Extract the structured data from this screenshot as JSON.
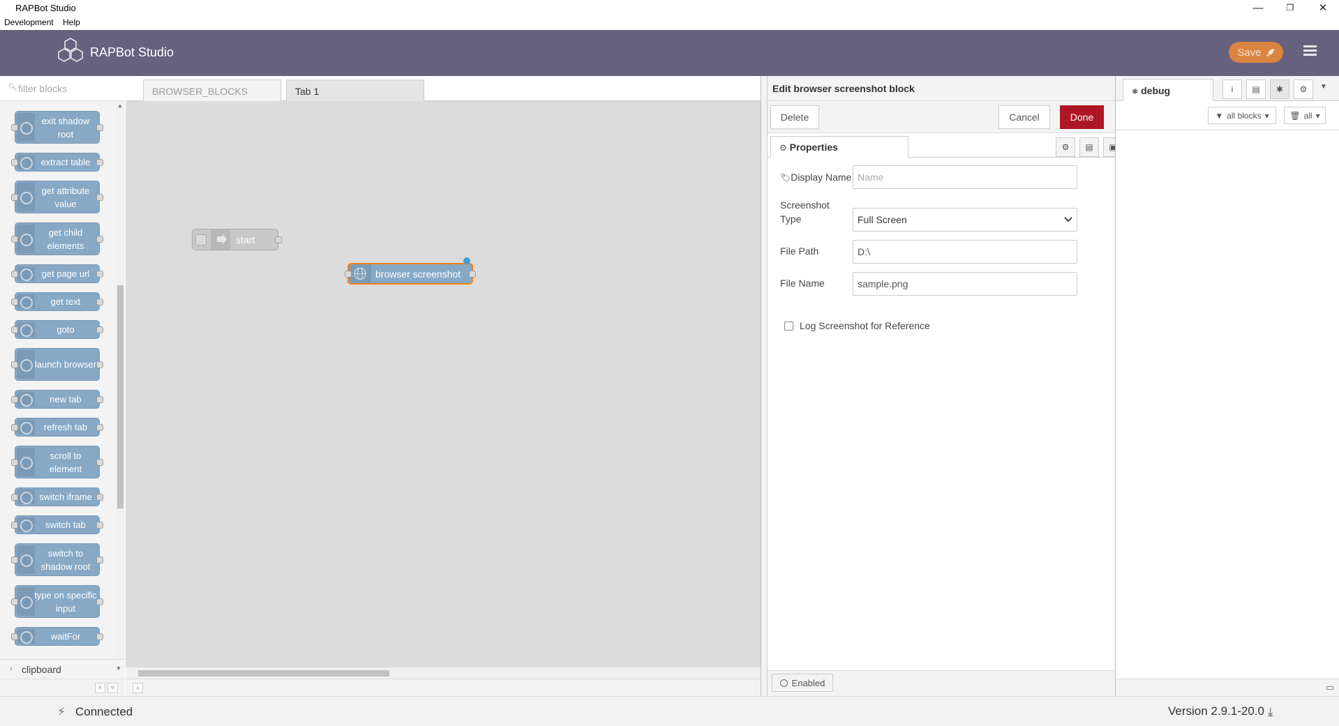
{
  "window": {
    "title": "RAPBot Studio",
    "minimize": "—",
    "restore": "❐",
    "close": "✕"
  },
  "menu": [
    "Development",
    "Help"
  ],
  "header": {
    "brand": "RAPBot Studio",
    "save_label": "Save",
    "accent": "#d98440"
  },
  "palette": {
    "filter_placeholder": "filter blocks",
    "blocks": [
      {
        "label": "exit shadow root"
      },
      {
        "label": "extract table"
      },
      {
        "label": "get attribute value"
      },
      {
        "label": "get child elements"
      },
      {
        "label": "get page url"
      },
      {
        "label": "get text"
      },
      {
        "label": "goto"
      },
      {
        "label": "launch browser"
      },
      {
        "label": "new tab"
      },
      {
        "label": "refresh tab"
      },
      {
        "label": "scroll to element"
      },
      {
        "label": "switch iframe"
      },
      {
        "label": "switch tab"
      },
      {
        "label": "switch to shadow root"
      },
      {
        "label": "type on specific input"
      },
      {
        "label": "waitFor"
      }
    ],
    "category": "clipboard"
  },
  "workspace": {
    "tabs": [
      "BROWSER_BLOCKS",
      "Tab 1"
    ],
    "active_tab": "Tab 1",
    "nodes": {
      "start": "start",
      "browser": "browser screenshot"
    }
  },
  "editor": {
    "title": "Edit browser screenshot block",
    "delete_label": "Delete",
    "cancel_label": "Cancel",
    "done_label": "Done",
    "properties_tab": "Properties",
    "display_name_label": "Display Name",
    "display_name_placeholder": "Name",
    "display_name_value": "",
    "screenshot_type_label_1": "Screenshot",
    "screenshot_type_label_2": "Type",
    "screenshot_type_value": "Full Screen",
    "file_path_label": "File Path",
    "file_path_value": "D:\\",
    "file_name_label": "File Name",
    "file_name_value": "sample.png",
    "log_checkbox_label": "Log Screenshot for Reference",
    "enabled_label": "Enabled"
  },
  "sidebar": {
    "debug_tab": "debug",
    "filter_all_blocks": "all blocks",
    "filter_all": "all"
  },
  "status": {
    "connection": "Connected",
    "version": "Version 2.9.1-20.0"
  }
}
